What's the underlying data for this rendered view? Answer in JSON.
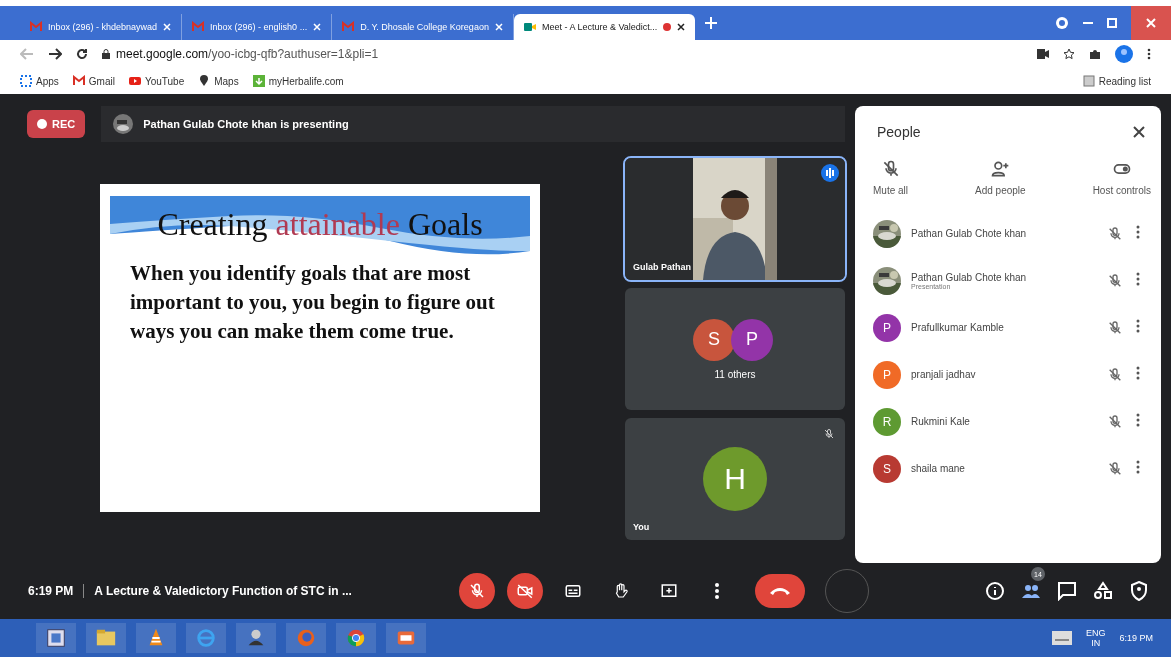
{
  "browser": {
    "tabs": [
      {
        "title": "Inbox (296) - khdebnaywad",
        "selected": false,
        "recording": false
      },
      {
        "title": "Inbox (296) - english0 ...",
        "selected": false,
        "recording": false
      },
      {
        "title": "D. Y. Dhosale College Koregaon",
        "selected": false,
        "recording": false
      },
      {
        "title": "Meet - A Lecture & Valedict...",
        "selected": true,
        "recording": true
      }
    ],
    "url_host": "meet.google.com",
    "url_path": "/yoo-icbg-qfb?authuser=1&pli=1",
    "bookmarks": [
      "Apps",
      "Gmail",
      "YouTube",
      "Maps",
      "myHerbalife.com"
    ],
    "reading_list": "Reading list"
  },
  "meet": {
    "rec": "REC",
    "presenting": "Pathan Gulab Chote khan is presenting",
    "slide": {
      "title_before": "Creating ",
      "title_highlight": "attainable",
      "title_after": " Goals",
      "body": "When you identify goals that are most important to you, you begin to figure out ways you can make them come true."
    },
    "tiles": [
      {
        "kind": "video",
        "name": "Gulab Pathan",
        "speaking": true
      },
      {
        "kind": "group",
        "label": "11 others",
        "avatars": [
          {
            "letter": "S",
            "color": "#c8553d"
          },
          {
            "letter": "P",
            "color": "#9334a8"
          }
        ]
      },
      {
        "kind": "self",
        "name": "You",
        "muted": true,
        "avatars": [
          {
            "letter": "H",
            "color": "#6e9a2c"
          }
        ]
      }
    ],
    "people": {
      "title": "People",
      "actions": [
        "Mute all",
        "Add people",
        "Host controls"
      ],
      "participants": [
        {
          "name": "Pathan Gulab Chote khan",
          "kind": "picture"
        },
        {
          "name": "Pathan Gulab Chote khan",
          "subtitle": "Presentation",
          "kind": "picture"
        },
        {
          "name": "Prafullkumar Kamble",
          "kind": "letter",
          "letter": "P",
          "color": "#9334a8"
        },
        {
          "name": "pranjali jadhav",
          "kind": "letter",
          "letter": "P",
          "color": "#f06a26"
        },
        {
          "name": "Rukmini Kale",
          "kind": "letter",
          "letter": "R",
          "color": "#5e9a32"
        },
        {
          "name": "shaila mane",
          "kind": "letter",
          "letter": "S",
          "color": "#b83a32"
        }
      ]
    },
    "bottom": {
      "time": "6:19 PM",
      "meeting_title": "A Lecture & Valedictory Function of STC in ...",
      "mic_on": false,
      "camera_on": false,
      "people_count": "14"
    }
  },
  "taskbar": {
    "lang": "ENG",
    "region": "IN",
    "time": "6:19 PM"
  }
}
